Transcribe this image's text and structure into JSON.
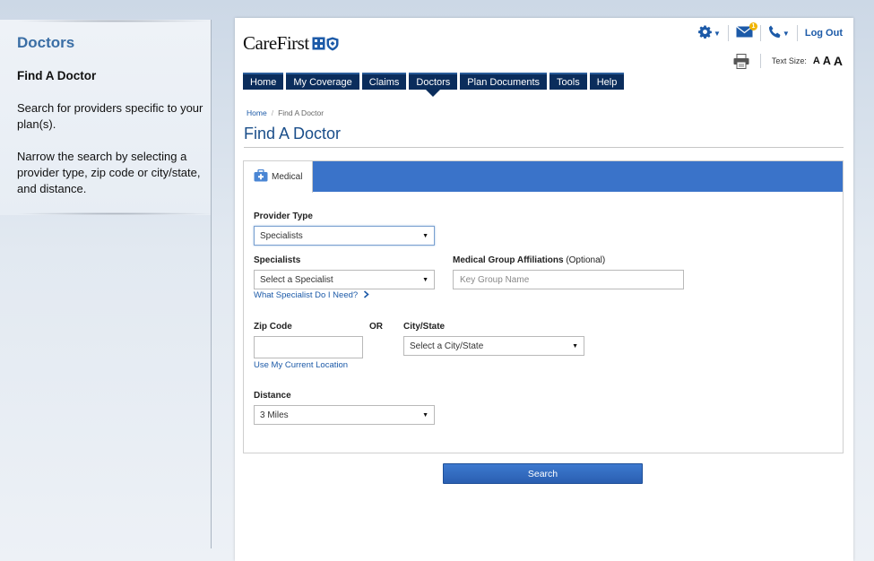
{
  "sidebar": {
    "title": "Doctors",
    "subtitle": "Find A Doctor",
    "para1": "Search for providers specific to your plan(s).",
    "para2": "Narrow the search by selecting a provider type, zip code or city/state, and distance."
  },
  "header": {
    "logo_text": "CareFirst",
    "message_badge": "1",
    "logout": "Log Out",
    "text_size_label": "Text Size:",
    "text_size_options": [
      "A",
      "A",
      "A"
    ],
    "icons": [
      "gear-icon",
      "mail-icon",
      "phone-icon",
      "print-icon"
    ]
  },
  "nav": {
    "tabs": [
      "Home",
      "My Coverage",
      "Claims",
      "Doctors",
      "Plan Documents",
      "Tools",
      "Help"
    ],
    "active": "Doctors"
  },
  "breadcrumb": {
    "home": "Home",
    "current": "Find A Doctor"
  },
  "page_title": "Find A Doctor",
  "tab": {
    "label": "Medical"
  },
  "form": {
    "provider_type": {
      "label": "Provider Type",
      "value": "Specialists"
    },
    "specialists": {
      "label": "Specialists",
      "value": "Select a Specialist",
      "help_link": "What Specialist Do I Need?"
    },
    "group": {
      "label": "Medical Group Affiliations",
      "optional": "(Optional)",
      "placeholder": "Key Group Name"
    },
    "zip": {
      "label": "Zip Code",
      "value": "",
      "location_link": "Use My Current Location"
    },
    "or_label": "OR",
    "city_state": {
      "label": "City/State",
      "value": "Select a City/State"
    },
    "distance": {
      "label": "Distance",
      "value": "3 Miles"
    }
  },
  "search_button": "Search",
  "colors": {
    "nav_bg": "#0b2d5c",
    "accent": "#3a73c9",
    "link": "#1c5aa8",
    "title": "#3a6ea5"
  }
}
